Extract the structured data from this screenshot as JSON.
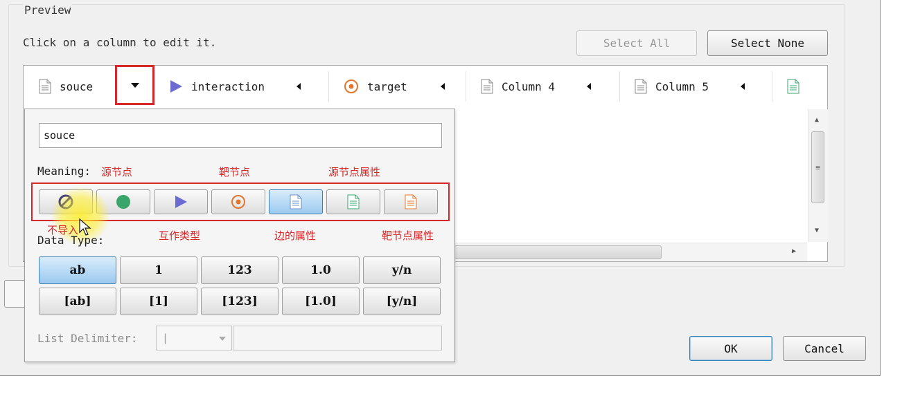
{
  "preview": {
    "title": "Preview",
    "hint": "Click on a column to edit it.",
    "select_all": "Select All",
    "select_none": "Select None"
  },
  "columns": [
    {
      "label": "souce",
      "icon": "document-icon"
    },
    {
      "label": "interaction",
      "icon": "play-triangle-icon"
    },
    {
      "label": "target",
      "icon": "target-icon"
    },
    {
      "label": "Column 4",
      "icon": "document-icon"
    },
    {
      "label": "Column 5",
      "icon": "document-icon"
    }
  ],
  "editor": {
    "name_value": "souce",
    "meaning_label": "Meaning:",
    "meaning_buttons": [
      {
        "icon": "not-import-icon",
        "color": "#1a1a8c"
      },
      {
        "icon": "source-node-icon",
        "color": "#3aa56b"
      },
      {
        "icon": "interaction-type-icon",
        "color": "#6b6bd1"
      },
      {
        "icon": "target-node-icon",
        "color": "#e2762c"
      },
      {
        "icon": "edge-attribute-icon",
        "color": "#6a8fc0",
        "selected": true
      },
      {
        "icon": "source-node-attribute-icon",
        "color": "#3aa56b"
      },
      {
        "icon": "target-node-attribute-icon",
        "color": "#e2762c"
      }
    ],
    "annotations": {
      "source_node": "源节点",
      "target_node": "靶节点",
      "source_node_attr": "源节点属性",
      "no_import": "不导入",
      "interaction_type": "互作类型",
      "edge_attr": "边的属性",
      "target_node_attr": "靶节点属性"
    },
    "data_type_label": "Data Type:",
    "data_types": [
      "ab",
      "1",
      "123",
      "1.0",
      "y/n"
    ],
    "list_types": [
      "[ab]",
      "[1]",
      "[123]",
      "[1.0]",
      "[y/n]"
    ],
    "list_delimiter_label": "List Delimiter:",
    "list_delimiter_value": "|"
  },
  "buttons": {
    "ok": "OK",
    "cancel": "Cancel"
  },
  "colors": {
    "highlight": "#d6282a",
    "selected": "#9cc9ef"
  }
}
